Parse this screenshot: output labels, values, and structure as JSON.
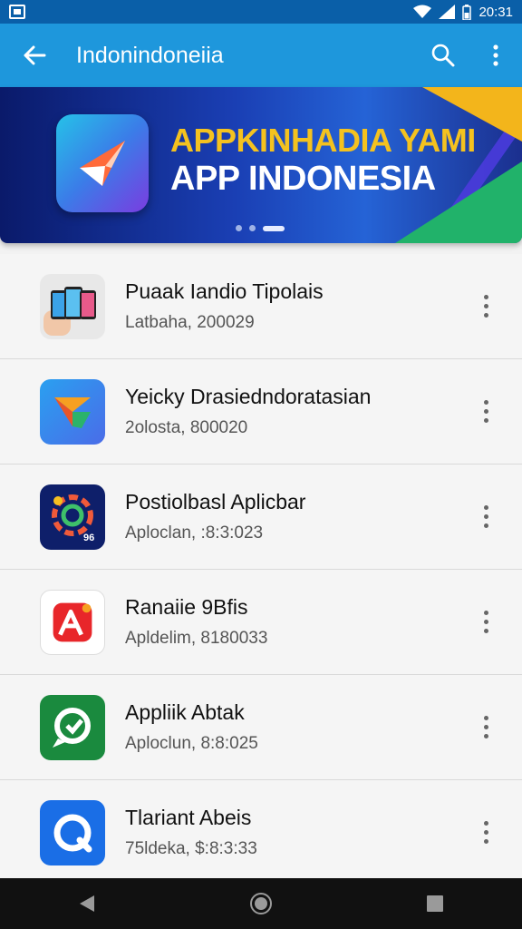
{
  "status_bar": {
    "time": "20:31",
    "wifi_icon": "wifi-icon",
    "signal_icon": "signal-icon",
    "battery_icon": "battery-icon"
  },
  "app_bar": {
    "title": "Indonindoneiia",
    "back_icon": "arrow-back-icon",
    "search_icon": "search-icon",
    "more_icon": "more-vert-icon"
  },
  "banner": {
    "heading_line1": "APPKINHADIA YAMI",
    "heading_line2": "APP INDONESIA",
    "active_slide": 3,
    "slide_count": 3
  },
  "apps": [
    {
      "name": "Puaak Iandio Tipolais",
      "meta": "Latbaha, 200029",
      "icon": "phones-icon"
    },
    {
      "name": "Yeicky Drasiedndoratasian",
      "meta": "2olosta, 800020",
      "icon": "g-logo-icon"
    },
    {
      "name": "Postiolbasl Aplicbar",
      "meta": "Aploclan, :8:3:023",
      "icon": "gear-colorful-icon"
    },
    {
      "name": "Ranaiie 9Bfis",
      "meta": "Apldelim, 8180033",
      "icon": "red-a-icon"
    },
    {
      "name": "Appliik Abtak",
      "meta": "Aploclun, 8:8:025",
      "icon": "green-chat-icon"
    },
    {
      "name": "Tlariant Abeis",
      "meta": "75ldeka, $:8:3:33",
      "icon": "blue-circle-icon"
    }
  ],
  "nav": {
    "back": "nav-back-icon",
    "home": "nav-home-icon",
    "recents": "nav-recents-icon"
  },
  "colors": {
    "status_bar": "#0a5fa8",
    "app_bar": "#1e97dc",
    "banner_yellow": "#f4c21f"
  }
}
